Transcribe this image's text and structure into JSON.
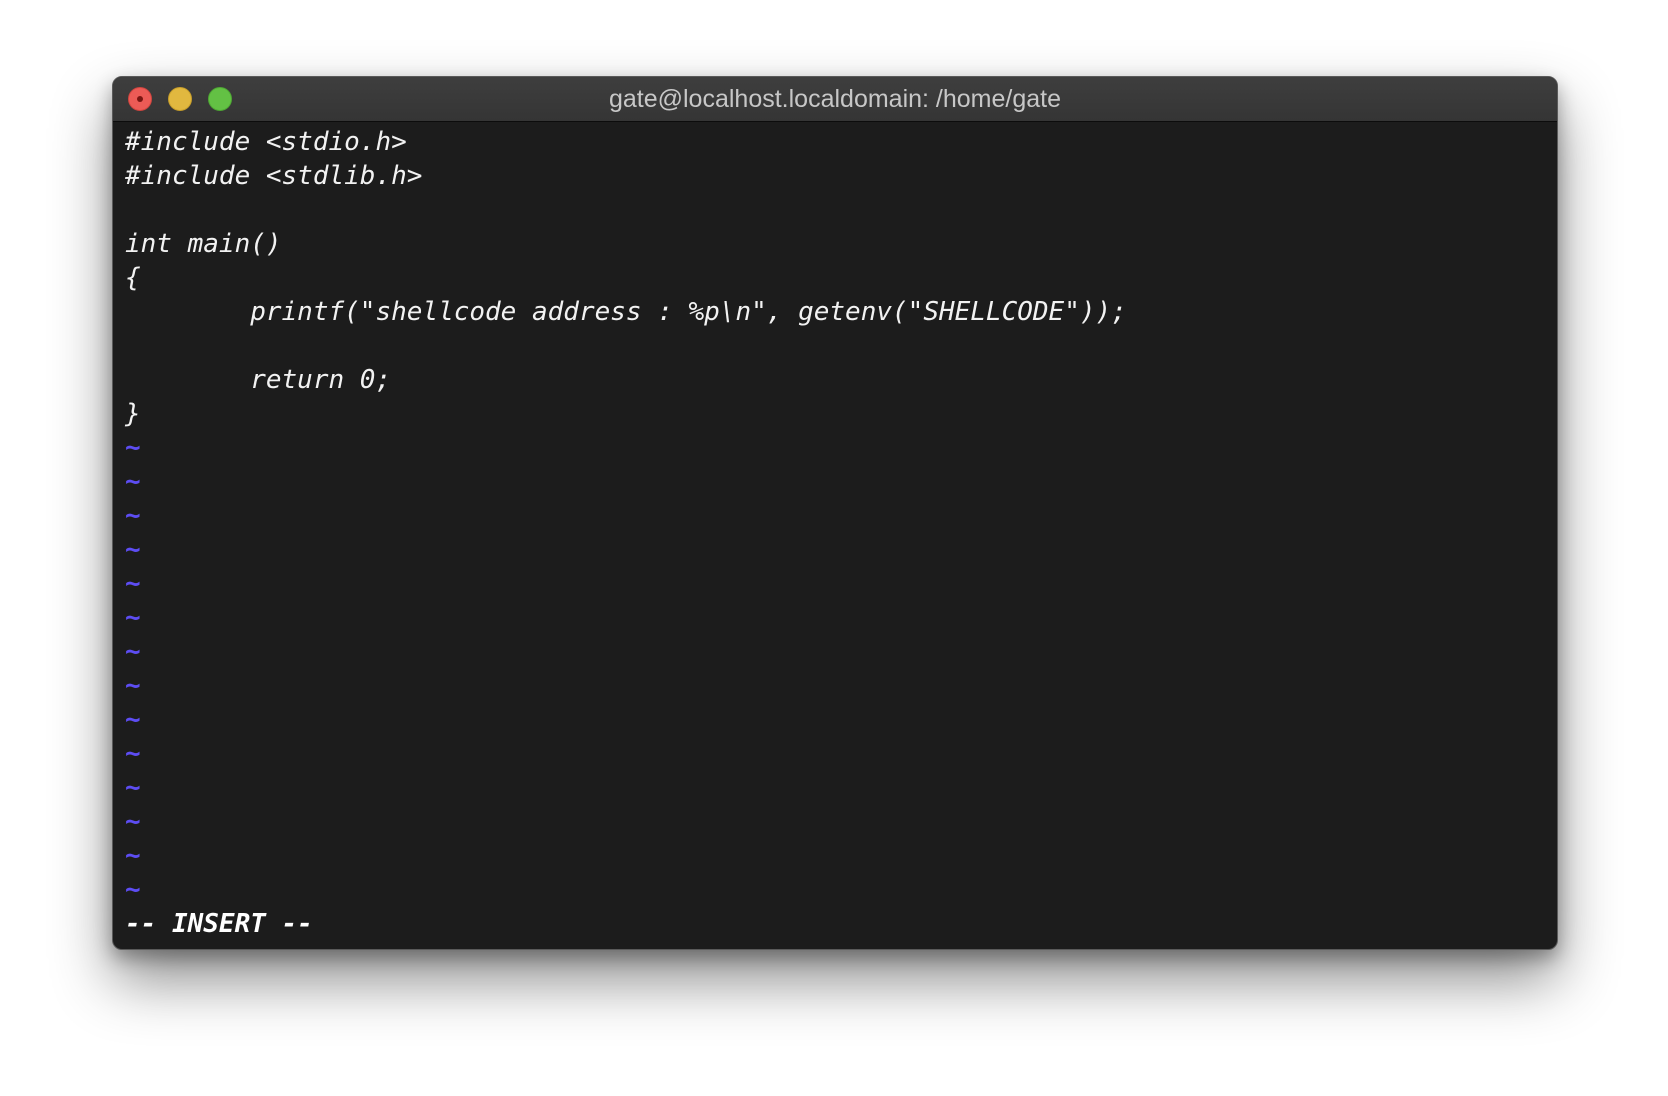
{
  "window": {
    "title": "gate@localhost.localdomain: /home/gate"
  },
  "editor": {
    "lines": [
      "#include <stdio.h>",
      "#include <stdlib.h>",
      "",
      "int main()",
      "{",
      "        printf(\"shellcode address : %p\\n\", getenv(\"SHELLCODE\"));",
      "",
      "        return 0;",
      "}"
    ],
    "tilde": "~",
    "mode_indicator": "-- INSERT --"
  },
  "colors": {
    "background": "#1c1c1c",
    "text": "#f2f2f2",
    "tilde": "#5d4df3",
    "titlebar": "#3a3a3a"
  }
}
